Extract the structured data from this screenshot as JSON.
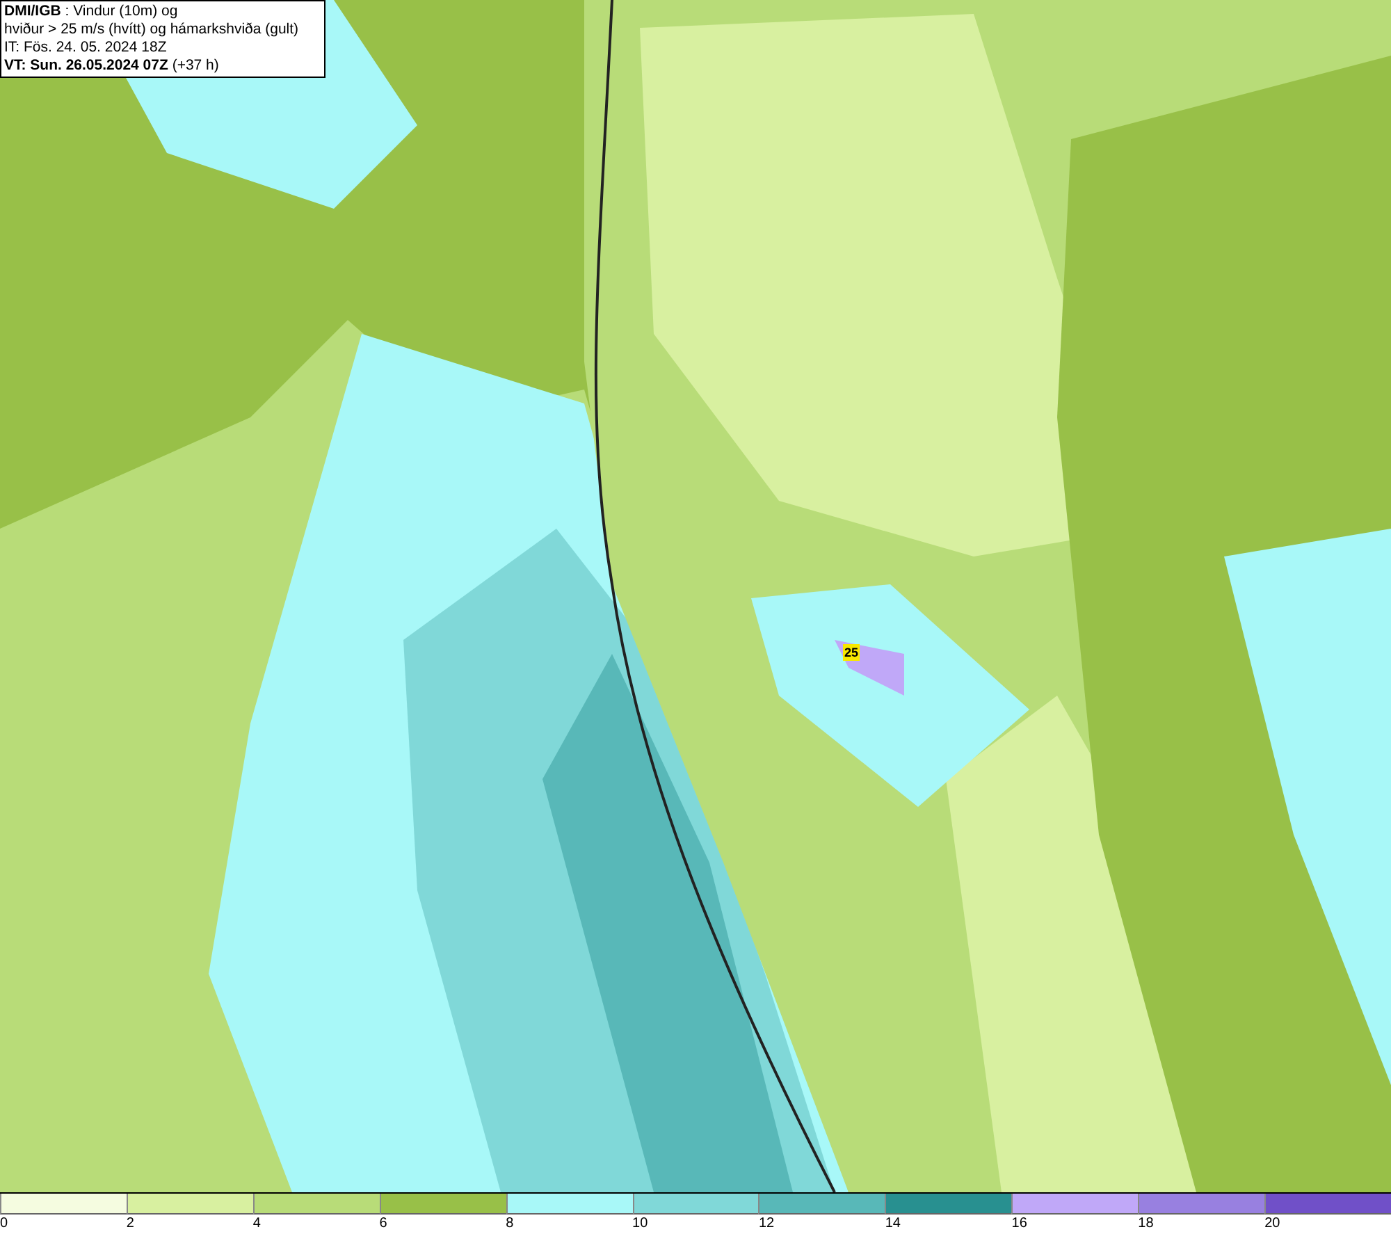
{
  "title_box": {
    "lines": [
      "**DMI/IGB** : Vindur (10m) og",
      "hviður > 25 m/s (hvítt) og hámarkshviða (gult)",
      "IT: Fös. 24. 05. 2024 18Z",
      "**VT: Sun. 26.05.2024 07Z** (+37 h)"
    ]
  },
  "map": {
    "gust_label": "25"
  },
  "legend": [
    {
      "label": "0",
      "color": "#f5fce0"
    },
    {
      "label": "2",
      "color": "#d8f0a0"
    },
    {
      "label": "4",
      "color": "#b8dc78"
    },
    {
      "label": "6",
      "color": "#98c048"
    },
    {
      "label": "8",
      "color": "#a8f8f8"
    },
    {
      "label": "10",
      "color": "#80d8d8"
    },
    {
      "label": "12",
      "color": "#58b8b8"
    },
    {
      "label": "14",
      "color": "#289090"
    },
    {
      "label": "16",
      "color": "#c0a8f8"
    },
    {
      "label": "18",
      "color": "#9880e0"
    },
    {
      "label": "20",
      "color": "#7050c8"
    }
  ]
}
